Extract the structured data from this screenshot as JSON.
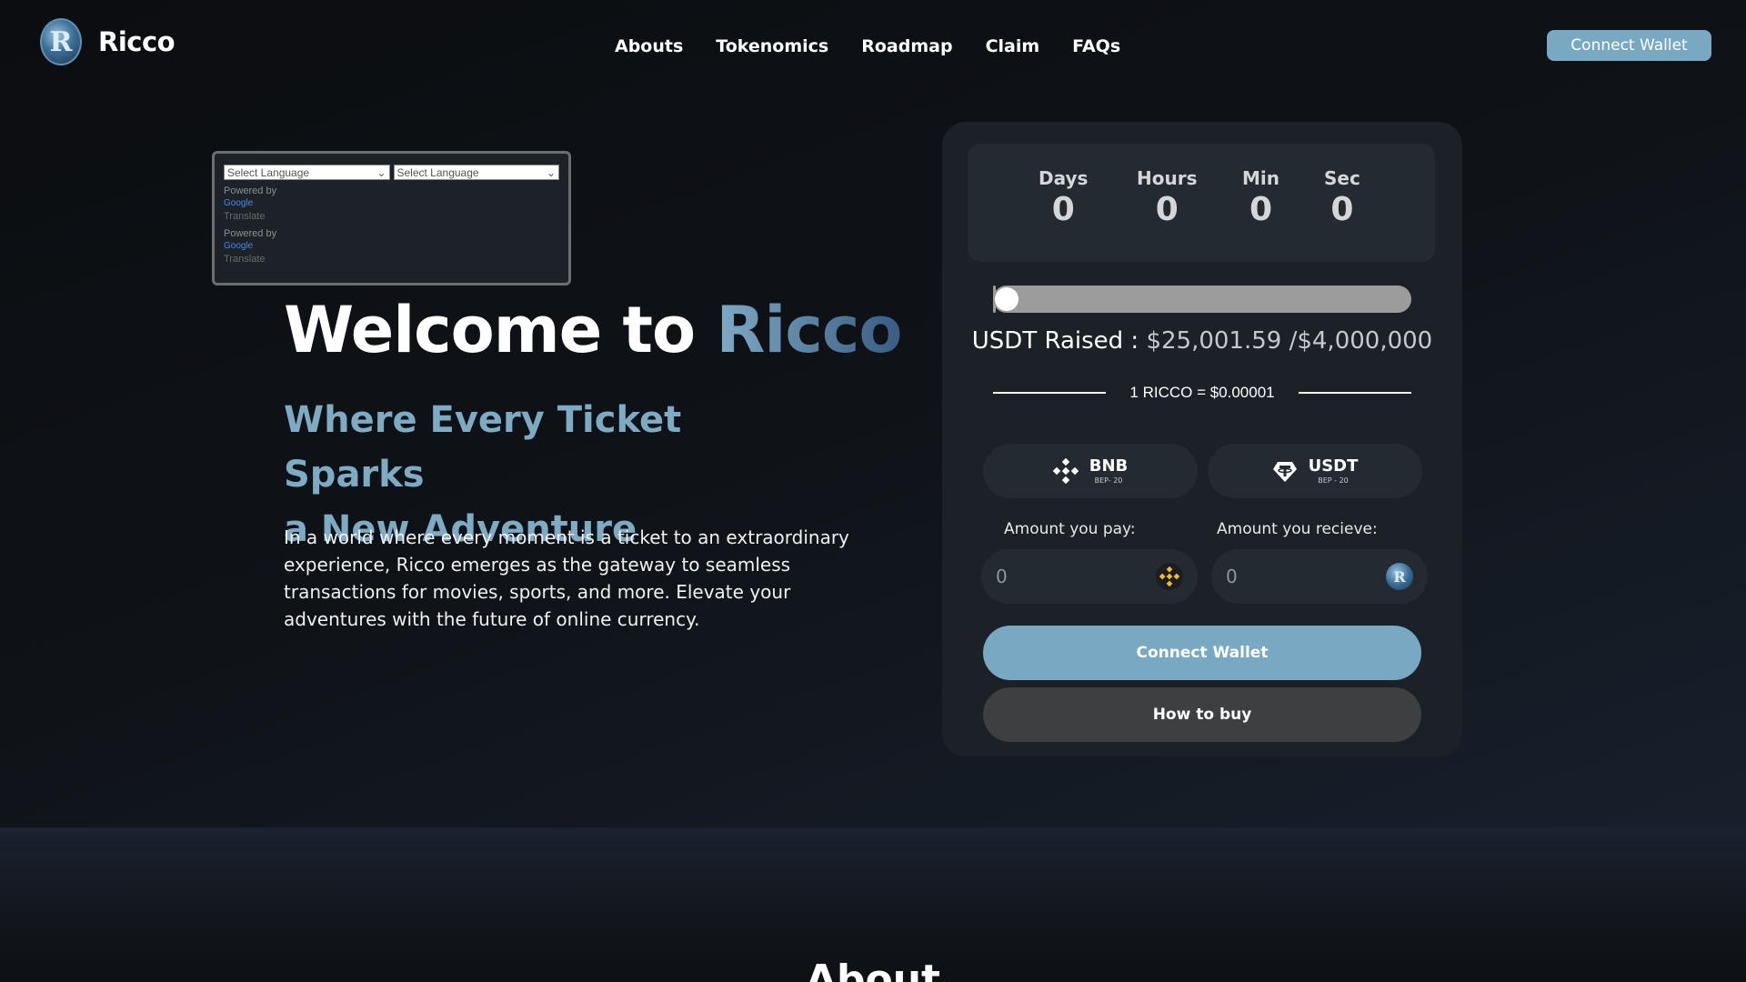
{
  "brand": {
    "name": "Ricco",
    "logo_letter": "R"
  },
  "nav": {
    "items": [
      "Abouts",
      "Tokenomics",
      "Roadmap",
      "Claim",
      "FAQs"
    ]
  },
  "header": {
    "connect_label": "Connect Wallet"
  },
  "translate": {
    "select_1": "Select Language",
    "select_2": "Select Language",
    "powered_by": "Powered by",
    "google": "Google",
    "translate": "Translate"
  },
  "hero": {
    "title_prefix": "Welcome to",
    "title_accent": "Ricco",
    "subtitle_line1": "Where Every Ticket Sparks",
    "subtitle_line2": "a New Adventure",
    "description": "In a world where every moment is a ticket to an extraordinary experience, Ricco emerges as the gateway to seamless transactions for movies, sports, and more. Elevate your adventures with the future of online currency."
  },
  "presale": {
    "timer": [
      {
        "label": "Days",
        "value": "0"
      },
      {
        "label": "Hours",
        "value": "0"
      },
      {
        "label": "Min",
        "value": "0"
      },
      {
        "label": "Sec",
        "value": "0"
      }
    ],
    "progress_fraction": 0.006,
    "raised_label": "USDT Raised :",
    "raised_amount": "$25,001.59 /$4,000,000",
    "rate": "1 RICCO = $0.00001",
    "currencies": [
      {
        "name": "BNB",
        "network": "BEP- 20",
        "icon": "bnb-icon"
      },
      {
        "name": "USDT",
        "network": "BEP - 20",
        "icon": "usdt-icon"
      }
    ],
    "pay_label": "Amount you pay:",
    "receive_label": "Amount you recieve:",
    "pay_value": "0",
    "receive_value": "0",
    "connect_label": "Connect Wallet",
    "how_to_buy_label": "How to buy"
  },
  "about": {
    "title": "About"
  },
  "colors": {
    "accent": "#78a8c2",
    "panel": "#1c2127",
    "bnb": "#f3ba2f"
  }
}
